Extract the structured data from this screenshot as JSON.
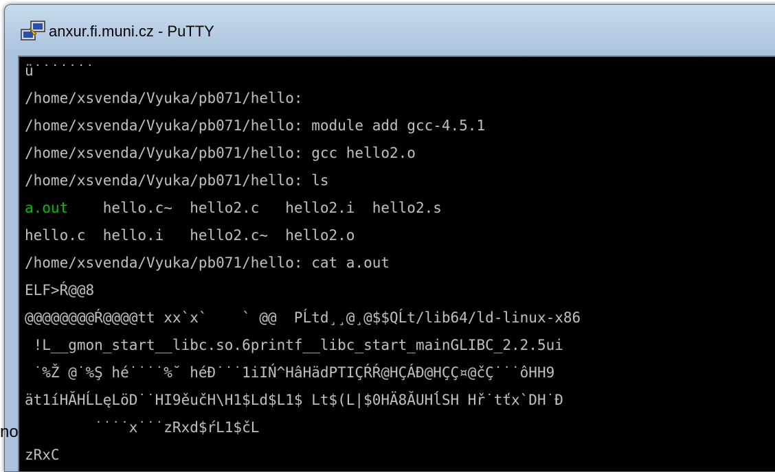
{
  "window": {
    "title": "anxur.fi.muni.cz - PuTTY",
    "icon": "putty-icon"
  },
  "terminal": {
    "lines": [
      "ü˙˙˙˙˙˙˙",
      "/home/xsvenda/Vyuka/pb071/hello:",
      "/home/xsvenda/Vyuka/pb071/hello: module add gcc-4.5.1",
      "/home/xsvenda/Vyuka/pb071/hello: gcc hello2.o",
      "/home/xsvenda/Vyuka/pb071/hello: ls",
      "hello.c  hello.i   hello2.c~  hello2.o",
      "/home/xsvenda/Vyuka/pb071/hello: cat a.out",
      "ELF>Ŕ@@8",
      "@@@@@@@@Ŕ@@@@tt xx`x`    ` @@  PĹtd¸¸@¸@$$QĹt/lib64/ld-linux-x86",
      " !L__gmon_start__libc.so.6printf__libc_start_mainGLIBC_2.2.5ui",
      " ˙%Ž @˙%Ş hé˙˙˙˙%˘ héĐ˙˙˙1iIŃ^HâHädPTIÇŔŔ@HÇÁĐ@HÇÇ¤@čÇ˙˙˙ôHH9",
      "ät1íHĂHĹLęLöD˙˙HI9ěučH\\H1$Ld$L1$ Lt$(L|$0HÄ8ĂUHĺSH Hř˙tťx`DH˙Đ",
      "        ˙˙˙˙x˙˙˙zRxd$ŕL1$čL",
      "zRxC"
    ],
    "ls_line": {
      "highlight": "a.out",
      "rest": "    hello.c~  hello2.c   hello2.i  hello2.s"
    }
  },
  "caption": "no programování",
  "colors": {
    "terminal_bg": "#000000",
    "terminal_fg": "#c0c0c0",
    "executable": "#00c000"
  }
}
